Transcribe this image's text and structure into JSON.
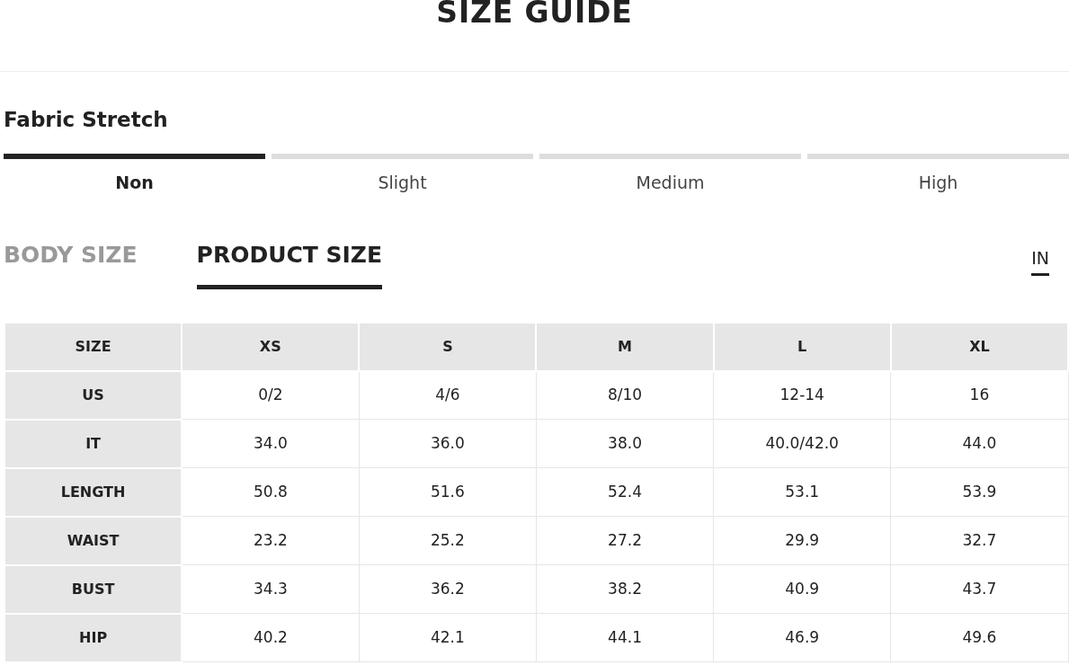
{
  "title": "SIZE GUIDE",
  "fabric_stretch": {
    "heading": "Fabric Stretch",
    "options": [
      {
        "label": "Non",
        "selected": true
      },
      {
        "label": "Slight",
        "selected": false
      },
      {
        "label": "Medium",
        "selected": false
      },
      {
        "label": "High",
        "selected": false
      }
    ]
  },
  "size_tabs": [
    {
      "label": "BODY SIZE",
      "selected": false
    },
    {
      "label": "PRODUCT SIZE",
      "selected": true
    }
  ],
  "units": [
    {
      "label": "IN",
      "selected": true
    }
  ],
  "table": {
    "columns": [
      "SIZE",
      "XS",
      "S",
      "M",
      "L",
      "XL"
    ],
    "rows": [
      [
        "US",
        "0/2",
        "4/6",
        "8/10",
        "12-14",
        "16"
      ],
      [
        "IT",
        "34.0",
        "36.0",
        "38.0",
        "40.0/42.0",
        "44.0"
      ],
      [
        "LENGTH",
        "50.8",
        "51.6",
        "52.4",
        "53.1",
        "53.9"
      ],
      [
        "WAIST",
        "23.2",
        "25.2",
        "27.2",
        "29.9",
        "32.7"
      ],
      [
        "BUST",
        "34.3",
        "36.2",
        "38.2",
        "40.9",
        "43.7"
      ],
      [
        "HIP",
        "40.2",
        "42.1",
        "44.1",
        "46.9",
        "49.6"
      ]
    ]
  }
}
